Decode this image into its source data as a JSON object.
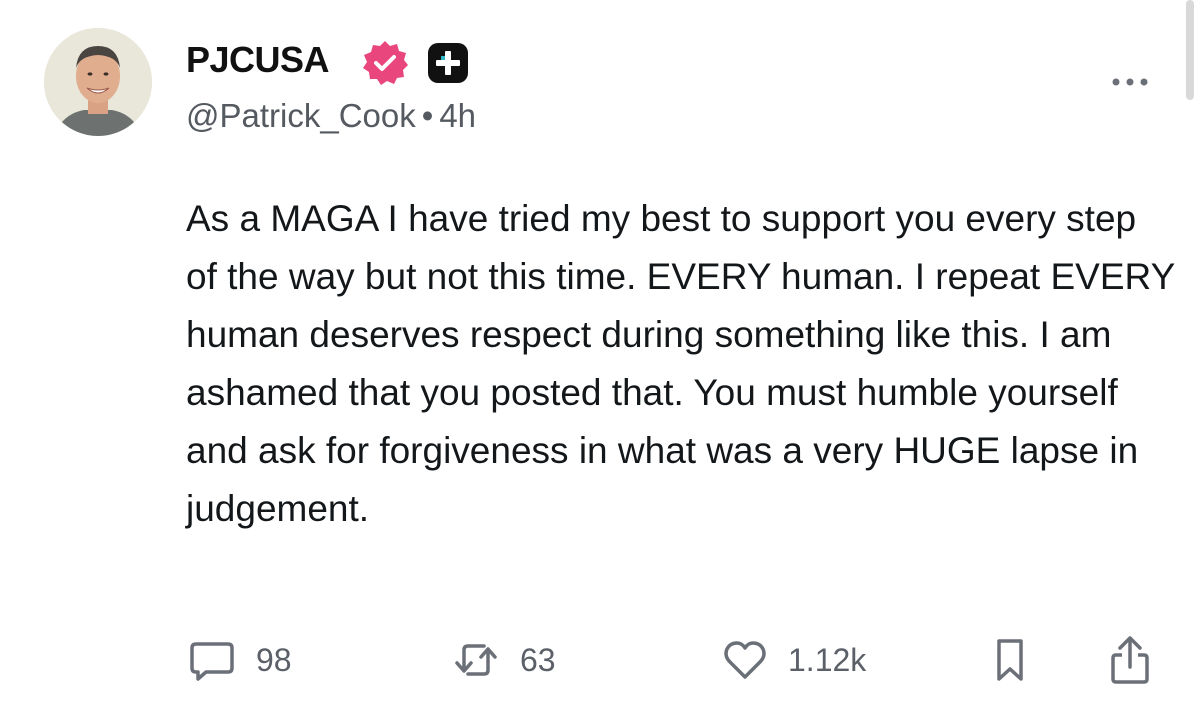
{
  "post": {
    "author": {
      "display_name": "PJCUSA",
      "handle": "@Patrick_Cook",
      "separator": "•",
      "timestamp": "4h",
      "verified_icon": "verified-badge-icon",
      "plus_icon": "plus-badge-icon"
    },
    "more_icon": "more-dots-icon",
    "body": "As a MAGA I have tried my best to support you every step of the way but not this time. EVERY human. I repeat EVERY human deserves respect during something like this. I am ashamed that you posted that. You must humble yourself and ask for forgiveness in what was a very HUGE lapse in judgement.",
    "actions": {
      "replies": {
        "icon": "comment-icon",
        "count": "98"
      },
      "reposts": {
        "icon": "repost-icon",
        "count": "63"
      },
      "likes": {
        "icon": "heart-icon",
        "count": "1.12k"
      },
      "bookmark": {
        "icon": "bookmark-icon"
      },
      "share": {
        "icon": "share-icon"
      }
    }
  },
  "colors": {
    "verified": "#e8467c",
    "plus_badge": "#111111",
    "muted_text": "#555a61",
    "icon": "#6b7078"
  }
}
